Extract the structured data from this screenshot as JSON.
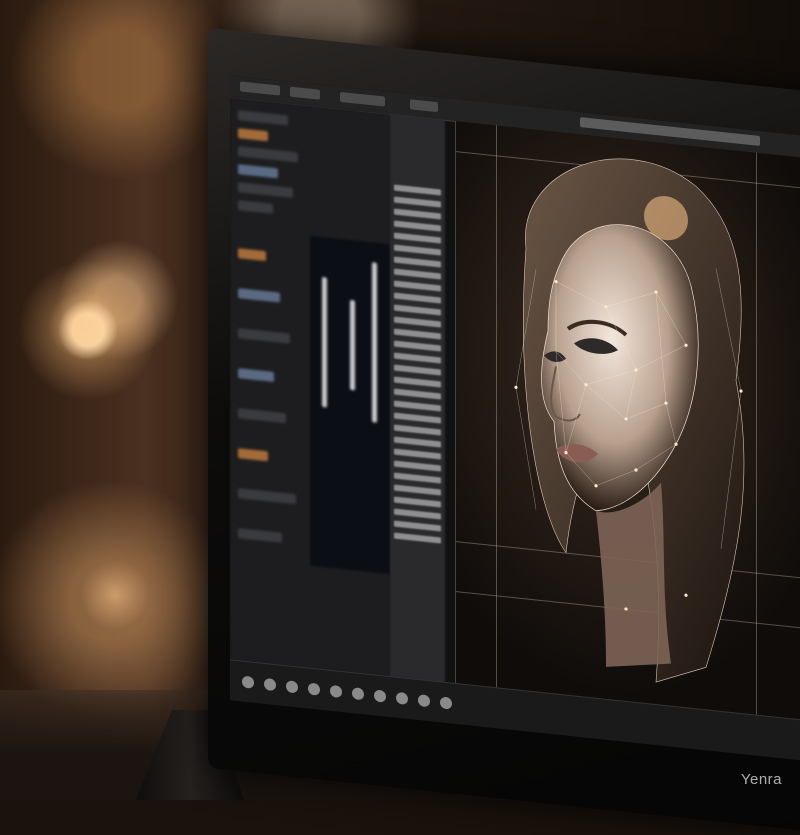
{
  "scene": {
    "subject": "computer-monitor",
    "screen_content": "wireframe-portrait-editor"
  },
  "colors": {
    "ambient": "#2a1a0f",
    "panel": "#1d1d1f",
    "wireframe": "#e8dcd0",
    "warm_accent": "#a46a38"
  },
  "watermark": {
    "text": "Yenra"
  }
}
